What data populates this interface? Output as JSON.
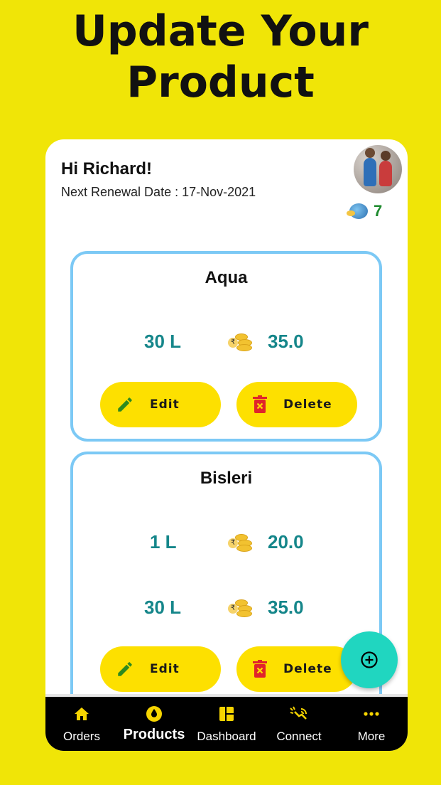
{
  "promo": {
    "line1": "Update Your",
    "line2": "Product"
  },
  "header": {
    "greeting": "Hi Richard!",
    "renewal": "Next Renewal Date : 17-Nov-2021",
    "coins": "7"
  },
  "products": [
    {
      "name": "Aqua",
      "prices": [
        {
          "qty": "30 L",
          "price": "35.0"
        }
      ],
      "edit_label": "Edit",
      "delete_label": "Delete"
    },
    {
      "name": "Bisleri",
      "prices": [
        {
          "qty": "1 L",
          "price": "20.0"
        },
        {
          "qty": "30 L",
          "price": "35.0"
        }
      ],
      "edit_label": "Edit",
      "delete_label": "Delete"
    }
  ],
  "nav": [
    {
      "label": "Orders",
      "icon": "home-icon"
    },
    {
      "label": "Products",
      "icon": "water-drop-icon",
      "active": true
    },
    {
      "label": "Dashboard",
      "icon": "dashboard-icon"
    },
    {
      "label": "Connect",
      "icon": "connect-icon"
    },
    {
      "label": "More",
      "icon": "more-icon"
    }
  ],
  "colors": {
    "background": "#f0e507",
    "accent": "#15868a",
    "button": "#fde000",
    "fab": "#20d6c0",
    "card_border": "#7cc9f5"
  }
}
